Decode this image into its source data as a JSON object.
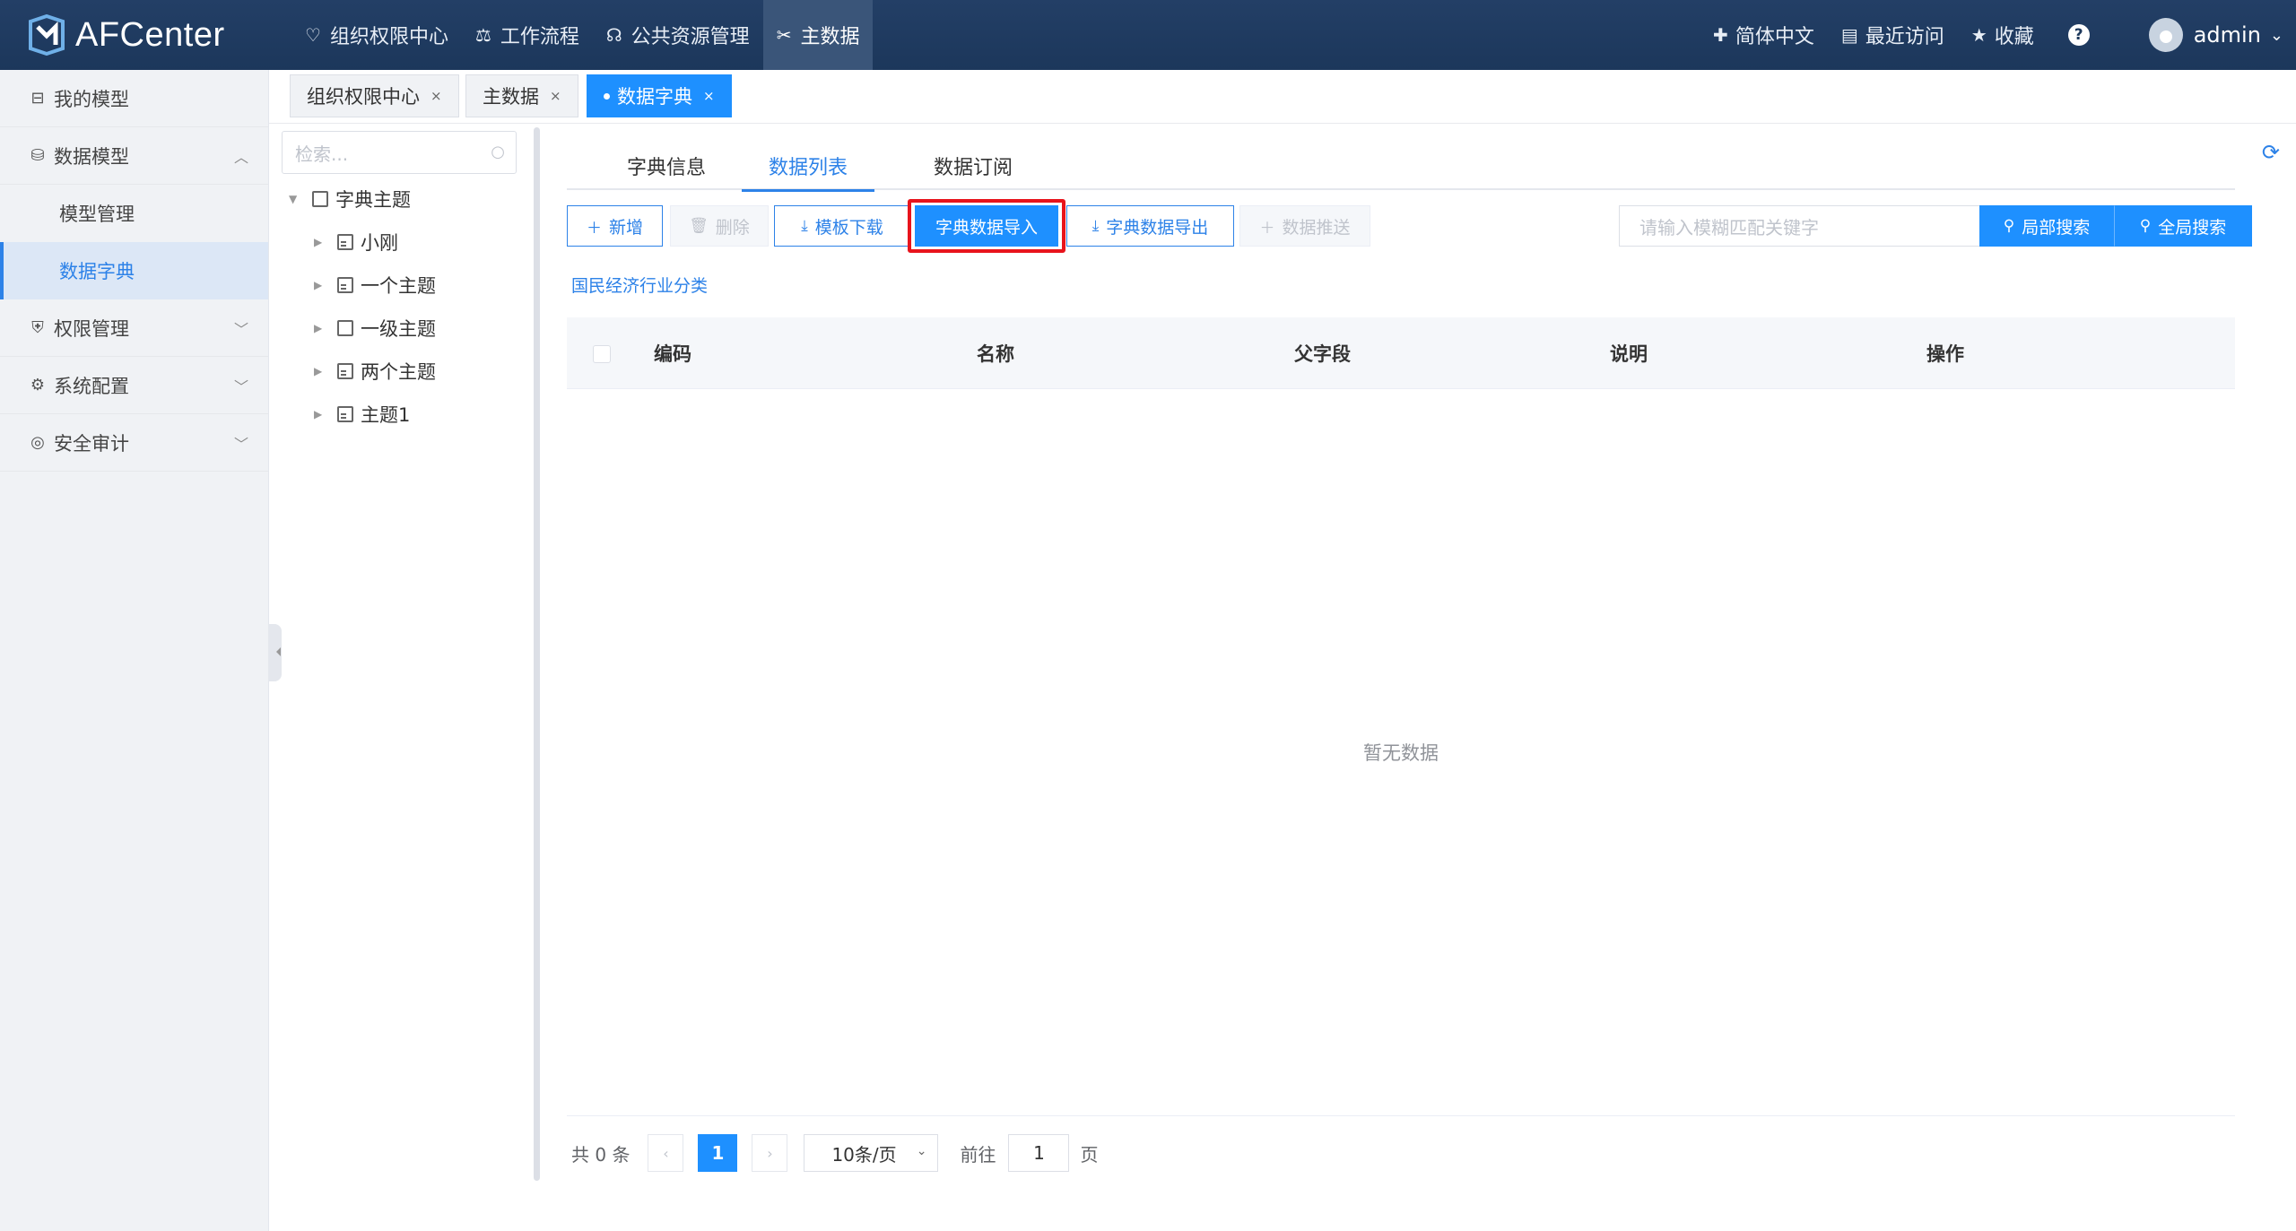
{
  "app": {
    "title": "AFCenter"
  },
  "topnav": {
    "items": [
      {
        "label": "组织权限中心",
        "icon": "shield-heart-icon"
      },
      {
        "label": "工作流程",
        "icon": "scale-icon"
      },
      {
        "label": "公共资源管理",
        "icon": "people-icon"
      },
      {
        "label": "主数据",
        "icon": "tools-icon",
        "active": true
      }
    ]
  },
  "topright": {
    "language": "简体中文",
    "recent": "最近访问",
    "favorites": "收藏",
    "user": "admin"
  },
  "sidebar": {
    "items": [
      {
        "label": "我的模型",
        "icon": "model-icon"
      },
      {
        "label": "数据模型",
        "icon": "database-icon",
        "expanded": true
      },
      {
        "label": "模型管理"
      },
      {
        "label": "数据字典",
        "active": true
      },
      {
        "label": "权限管理",
        "icon": "shield-icon"
      },
      {
        "label": "系统配置",
        "icon": "gear-icon"
      },
      {
        "label": "安全审计",
        "icon": "audit-icon"
      }
    ]
  },
  "page_tabs": [
    {
      "label": "组织权限中心"
    },
    {
      "label": "主数据"
    },
    {
      "label": "数据字典",
      "active": true
    }
  ],
  "tree": {
    "search_placeholder": "检索...",
    "root": "字典主题",
    "children": [
      "小刚",
      "一个主题",
      "一级主题",
      "两个主题",
      "主题1"
    ]
  },
  "sub_tabs": [
    "字典信息",
    "数据列表",
    "数据订阅"
  ],
  "toolbar": {
    "add": "新增",
    "delete": "删除",
    "template_download": "模板下载",
    "import": "字典数据导入",
    "export": "字典数据导出",
    "push": "数据推送",
    "search_placeholder": "请输入模糊匹配关键字",
    "local_search": "局部搜索",
    "global_search": "全局搜索"
  },
  "category_link": "国民经济行业分类",
  "table": {
    "columns": [
      "编码",
      "名称",
      "父字段",
      "说明",
      "操作"
    ],
    "rows": [],
    "empty_text": "暂无数据"
  },
  "pagination": {
    "total": "共 0 条",
    "current_page": "1",
    "page_size": "10条/页",
    "goto_prefix": "前往",
    "goto_value": "1",
    "goto_suffix": "页"
  },
  "colors": {
    "topbar": "#1c375b",
    "accent": "#1e90ff",
    "highlight": "#e8141c"
  }
}
